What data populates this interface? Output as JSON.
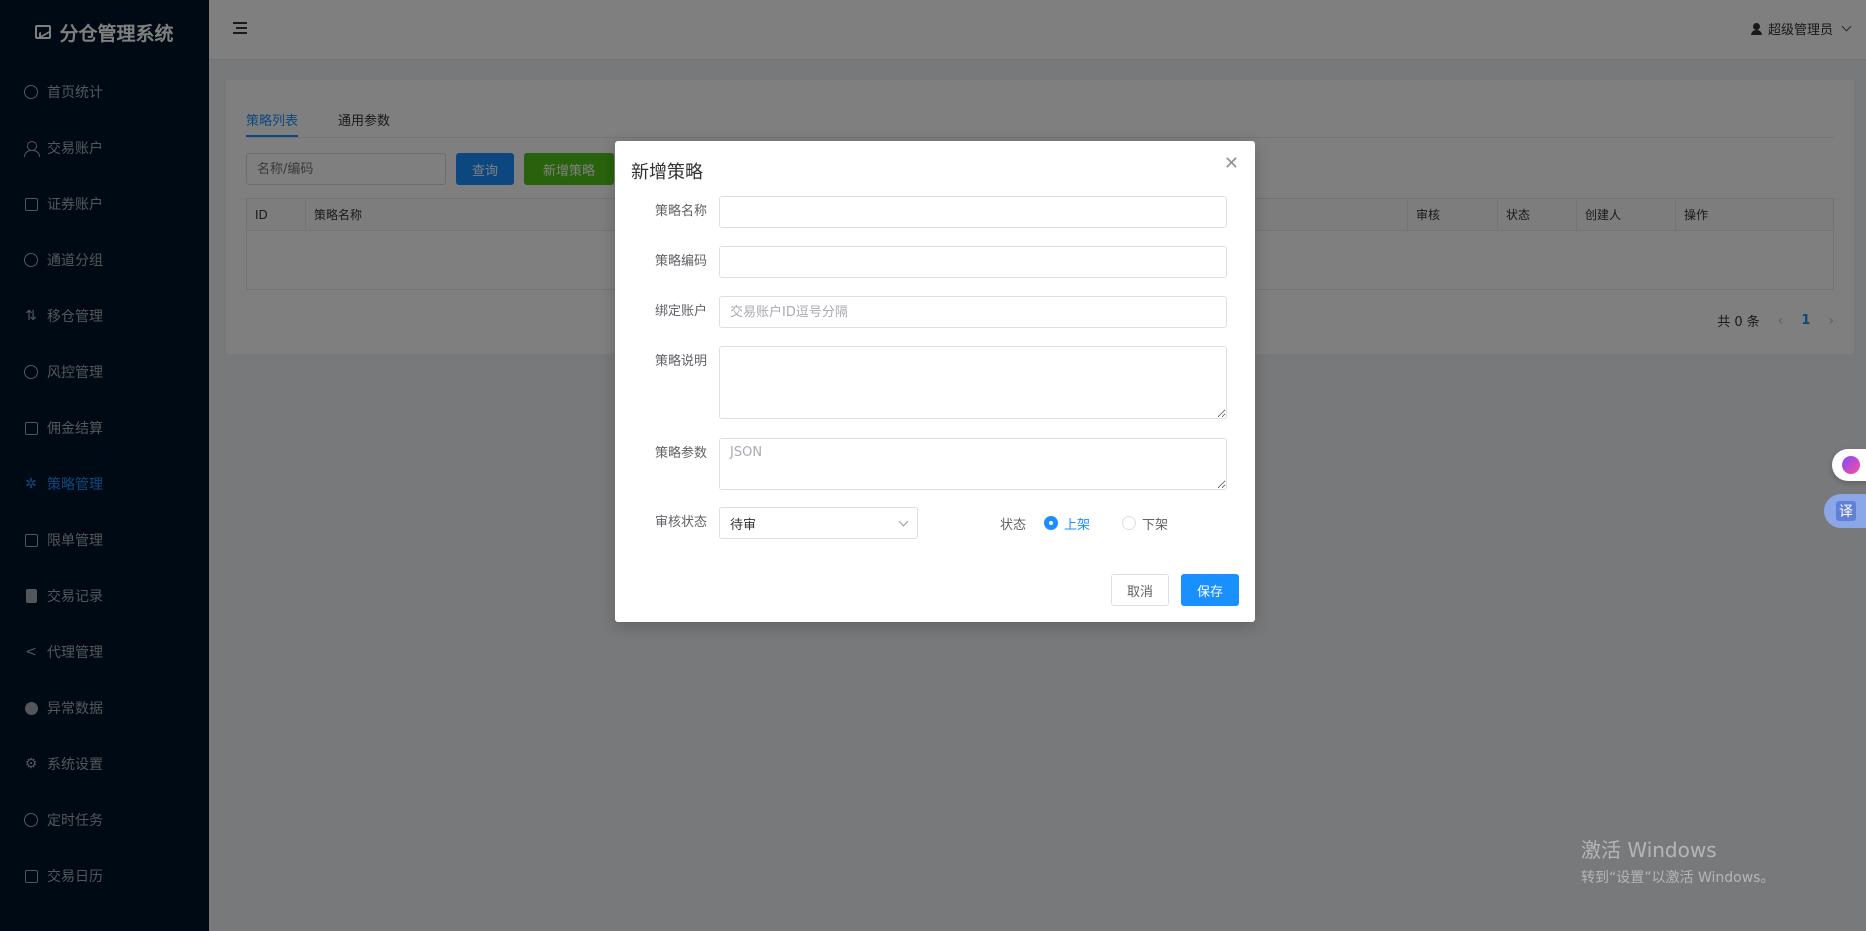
{
  "app": {
    "title": "分仓管理系统"
  },
  "sidebar": {
    "items": [
      {
        "label": "首页统计",
        "icon": "dashboard-icon",
        "active": false
      },
      {
        "label": "交易账户",
        "icon": "user-icon",
        "active": false
      },
      {
        "label": "证券账户",
        "icon": "folder-icon",
        "active": false
      },
      {
        "label": "通道分组",
        "icon": "group-icon",
        "active": false
      },
      {
        "label": "移仓管理",
        "icon": "transfer-icon",
        "active": false
      },
      {
        "label": "风控管理",
        "icon": "warning-icon",
        "active": false
      },
      {
        "label": "佣金结算",
        "icon": "wallet-icon",
        "active": false
      },
      {
        "label": "策略管理",
        "icon": "loading-icon",
        "active": true
      },
      {
        "label": "限单管理",
        "icon": "copy-icon",
        "active": false
      },
      {
        "label": "交易记录",
        "icon": "clipboard-icon",
        "active": false
      },
      {
        "label": "代理管理",
        "icon": "share-icon",
        "active": false
      },
      {
        "label": "异常数据",
        "icon": "exclamation-icon",
        "active": false
      },
      {
        "label": "系统设置",
        "icon": "gear-icon",
        "active": false
      },
      {
        "label": "定时任务",
        "icon": "timer-icon",
        "active": false
      },
      {
        "label": "交易日历",
        "icon": "calendar-icon",
        "active": false
      }
    ]
  },
  "header": {
    "user": "超级管理员"
  },
  "main": {
    "tabs": [
      {
        "label": "策略列表",
        "active": true
      },
      {
        "label": "通用参数",
        "active": false
      }
    ],
    "search": {
      "placeholder": "名称/编码"
    },
    "query_label": "查询",
    "add_label": "新增策略",
    "table": {
      "columns_left": [
        "ID",
        "策略名称"
      ],
      "columns_right": [
        "审核",
        "状态",
        "创建人",
        "操作"
      ]
    },
    "pager": {
      "total": "共 0 条",
      "page": "1"
    }
  },
  "modal": {
    "title": "新增策略",
    "fields": {
      "name_label": "策略名称",
      "code_label": "策略编码",
      "account_label": "绑定账户",
      "account_placeholder": "交易账户ID逗号分隔",
      "desc_label": "策略说明",
      "params_label": "策略参数",
      "params_placeholder": "JSON",
      "review_label": "审核状态",
      "review_value": "待审",
      "status_label": "状态",
      "status_on": "上架",
      "status_off": "下架"
    },
    "cancel_label": "取消",
    "save_label": "保存"
  },
  "watermark": {
    "line1": "激活 Windows",
    "line2": "转到“设置”以激活 Windows。"
  },
  "widgets": {
    "translate_label": "译"
  },
  "colors": {
    "accent": "#1890ff",
    "sidebar_bg": "#001529",
    "success": "#52c41a"
  }
}
